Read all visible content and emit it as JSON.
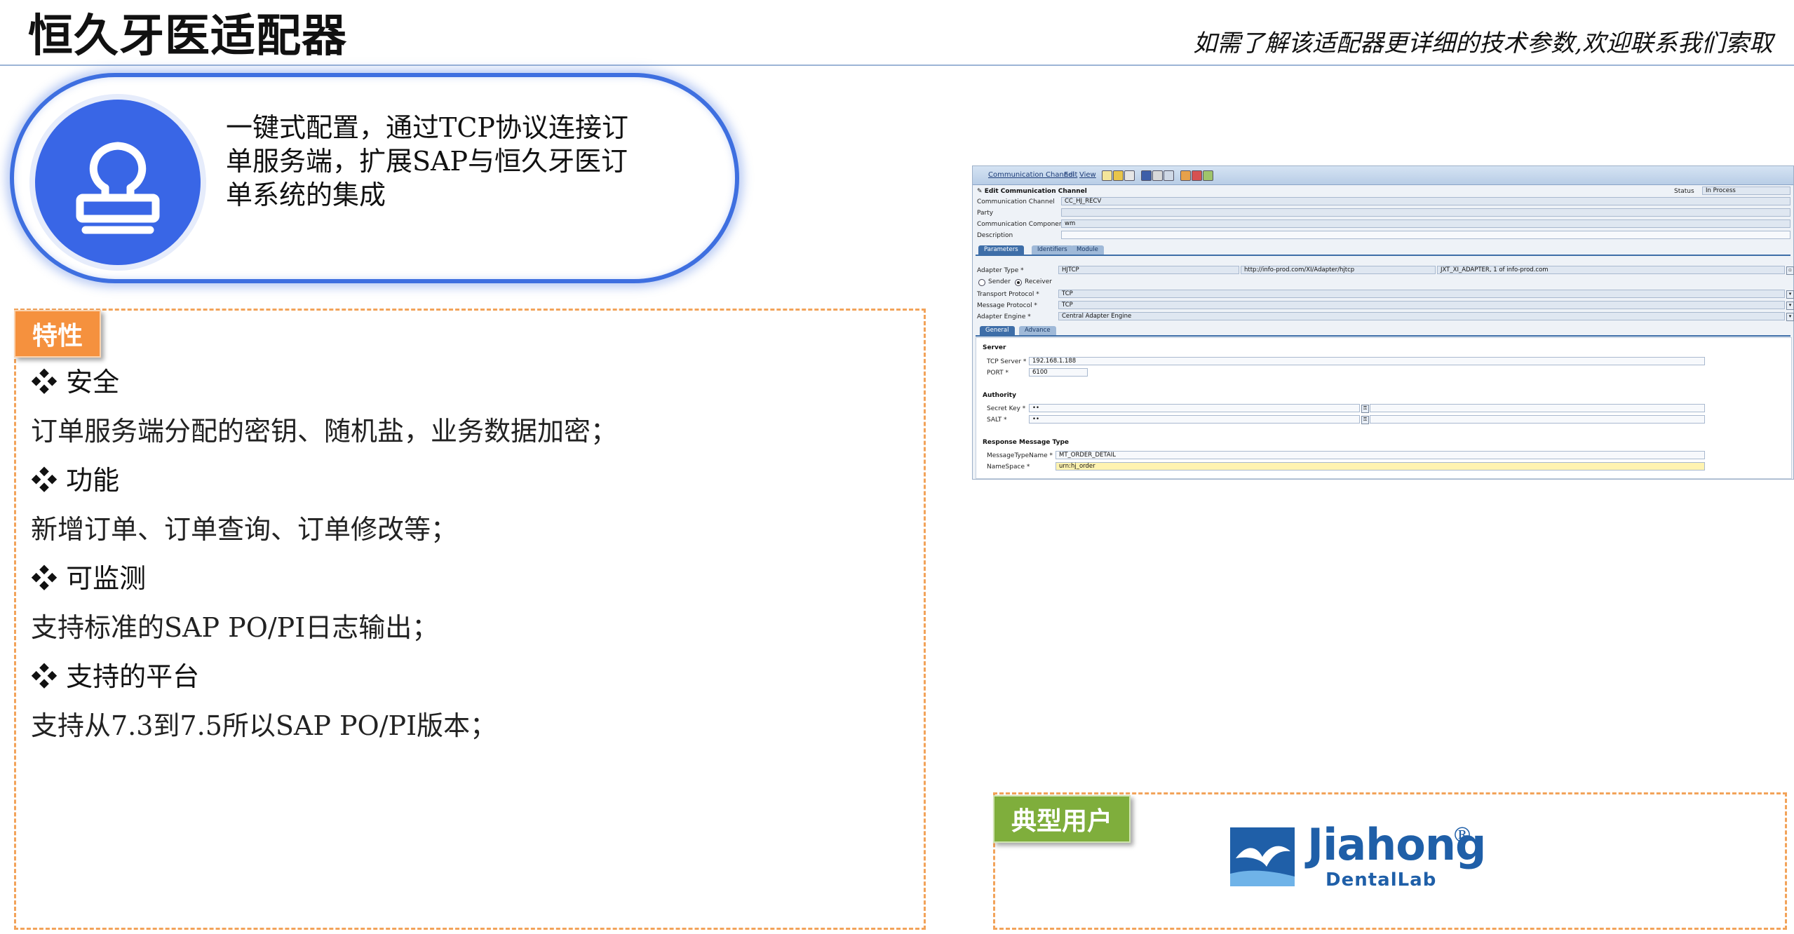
{
  "header": {
    "title": "恒久牙医适配器",
    "tagline": "如需了解该适配器更详细的技术参数,欢迎联系我们索取"
  },
  "intro": {
    "icon": "stamp-icon",
    "lines": [
      "一键式配置，通过TCP协议连接订",
      "单服务端，扩展SAP与恒久牙医订",
      "单系统的集成"
    ]
  },
  "features": {
    "tag": "特性",
    "bullet": "❖",
    "items": [
      {
        "heading": "安全",
        "desc": "订单服务端分配的密钥、随机盐，业务数据加密；"
      },
      {
        "heading": "功能",
        "desc": "新增订单、订单查询、订单修改等；"
      },
      {
        "heading": "可监测",
        "desc": "支持标准的SAP PO/PI日志输出；"
      },
      {
        "heading": "支持的平台",
        "desc": "支持从7.3到7.5所以SAP PO/PI版本；"
      }
    ]
  },
  "users": {
    "tag": "典型用户",
    "logo": {
      "word": "Jiahong",
      "sub": "DentalLab",
      "reg": "®",
      "color": "#1f5fa8"
    }
  },
  "sap": {
    "menu": [
      "Communication Channel",
      "Edit",
      "View"
    ],
    "form_title": "Edit Communication Channel",
    "status_label": "Status",
    "status_value": "In Process",
    "channel_label": "Communication Channel",
    "channel_value": "CC_HJ_RECV",
    "party_label": "Party",
    "party_value": "",
    "component_label": "Communication Component",
    "component_value": "wm",
    "description_label": "Description",
    "description_value": "",
    "tabs": [
      "Parameters",
      "Identifiers",
      "Module"
    ],
    "adapter_type_label": "Adapter Type *",
    "adapter_type_value": "HJTCP",
    "adapter_ns": "http://info-prod.com/XI/Adapter/hjtcp",
    "adapter_sw": "JXT_XI_ADAPTER, 1 of info-prod.com",
    "sender_label": "Sender",
    "receiver_label": "Receiver",
    "transport_label": "Transport Protocol *",
    "transport_value": "TCP",
    "message_label": "Message Protocol *",
    "message_value": "TCP",
    "engine_label": "Adapter Engine *",
    "engine_value": "Central Adapter Engine",
    "subtabs": [
      "General",
      "Advance"
    ],
    "server_title": "Server",
    "tcp_server_label": "TCP Server *",
    "tcp_server_value": "192.168.1.188",
    "port_label": "PORT *",
    "port_value": "6100",
    "authority_title": "Authority",
    "secret_label": "Secret Key *",
    "secret_value": "••",
    "salt_label": "SALT *",
    "salt_value": "••",
    "response_title": "Response Message Type",
    "msgtype_label": "MessageTypeName *",
    "msgtype_value": "MT_ORDER_DETAIL",
    "namespace_label": "NameSpace *",
    "namespace_value": "urn:hj_order"
  },
  "colors": {
    "accent_blue": "#3e6fe0",
    "feature_tag": "#f5913e",
    "users_tag": "#7fae3c",
    "dashed_border": "#f2a35a"
  }
}
